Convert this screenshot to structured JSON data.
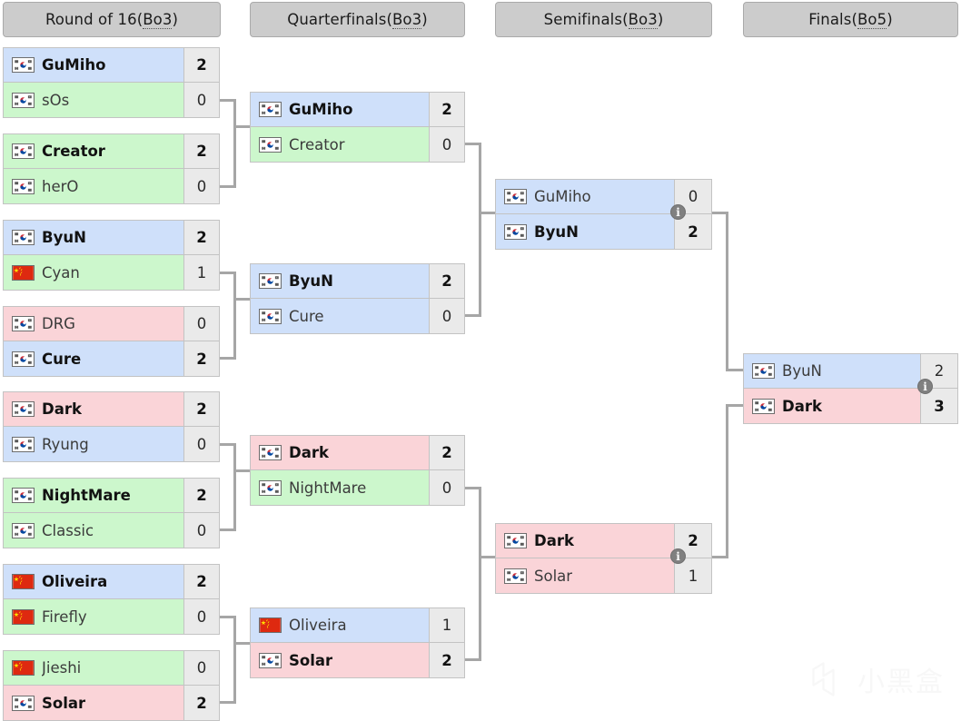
{
  "rounds": [
    {
      "id": "ro16",
      "label": "Round of 16 ",
      "format": "Bo3"
    },
    {
      "id": "qf",
      "label": "Quarterfinals ",
      "format": "Bo3"
    },
    {
      "id": "sf",
      "label": "Semifinals ",
      "format": "Bo3"
    },
    {
      "id": "f",
      "label": "Finals ",
      "format": "Bo5"
    }
  ],
  "colors": {
    "terran": "#cfe0fa",
    "protoss": "#ccf7cc",
    "zerg": "#fad4d8",
    "header": "#cccccc",
    "score_bg": "#eaeaea",
    "connector": "#a6a6a6"
  },
  "matches": {
    "ro16_1": {
      "top": {
        "name": "GuMiho",
        "score": "2",
        "flag": "kr",
        "race": "terran",
        "winner": true
      },
      "bottom": {
        "name": "sOs",
        "score": "0",
        "flag": "kr",
        "race": "protoss",
        "winner": false
      }
    },
    "ro16_2": {
      "top": {
        "name": "Creator",
        "score": "2",
        "flag": "kr",
        "race": "protoss",
        "winner": true
      },
      "bottom": {
        "name": "herO",
        "score": "0",
        "flag": "kr",
        "race": "protoss",
        "winner": false
      }
    },
    "ro16_3": {
      "top": {
        "name": "ByuN",
        "score": "2",
        "flag": "kr",
        "race": "terran",
        "winner": true
      },
      "bottom": {
        "name": "Cyan",
        "score": "1",
        "flag": "cn",
        "race": "protoss",
        "winner": false
      }
    },
    "ro16_4": {
      "top": {
        "name": "DRG",
        "score": "0",
        "flag": "kr",
        "race": "zerg",
        "winner": false
      },
      "bottom": {
        "name": "Cure",
        "score": "2",
        "flag": "kr",
        "race": "terran",
        "winner": true
      }
    },
    "ro16_5": {
      "top": {
        "name": "Dark",
        "score": "2",
        "flag": "kr",
        "race": "zerg",
        "winner": true
      },
      "bottom": {
        "name": "Ryung",
        "score": "0",
        "flag": "kr",
        "race": "terran",
        "winner": false
      }
    },
    "ro16_6": {
      "top": {
        "name": "NightMare",
        "score": "2",
        "flag": "kr",
        "race": "protoss",
        "winner": true
      },
      "bottom": {
        "name": "Classic",
        "score": "0",
        "flag": "kr",
        "race": "protoss",
        "winner": false
      }
    },
    "ro16_7": {
      "top": {
        "name": "Oliveira",
        "score": "2",
        "flag": "cn",
        "race": "terran",
        "winner": true
      },
      "bottom": {
        "name": "Firefly",
        "score": "0",
        "flag": "cn",
        "race": "protoss",
        "winner": false
      }
    },
    "ro16_8": {
      "top": {
        "name": "Jieshi",
        "score": "0",
        "flag": "cn",
        "race": "protoss",
        "winner": false
      },
      "bottom": {
        "name": "Solar",
        "score": "2",
        "flag": "kr",
        "race": "zerg",
        "winner": true
      }
    },
    "qf_1": {
      "top": {
        "name": "GuMiho",
        "score": "2",
        "flag": "kr",
        "race": "terran",
        "winner": true
      },
      "bottom": {
        "name": "Creator",
        "score": "0",
        "flag": "kr",
        "race": "protoss",
        "winner": false
      }
    },
    "qf_2": {
      "top": {
        "name": "ByuN",
        "score": "2",
        "flag": "kr",
        "race": "terran",
        "winner": true
      },
      "bottom": {
        "name": "Cure",
        "score": "0",
        "flag": "kr",
        "race": "terran",
        "winner": false
      }
    },
    "qf_3": {
      "top": {
        "name": "Dark",
        "score": "2",
        "flag": "kr",
        "race": "zerg",
        "winner": true
      },
      "bottom": {
        "name": "NightMare",
        "score": "0",
        "flag": "kr",
        "race": "protoss",
        "winner": false
      }
    },
    "qf_4": {
      "top": {
        "name": "Oliveira",
        "score": "1",
        "flag": "cn",
        "race": "terran",
        "winner": false
      },
      "bottom": {
        "name": "Solar",
        "score": "2",
        "flag": "kr",
        "race": "zerg",
        "winner": true
      }
    },
    "sf_1": {
      "top": {
        "name": "GuMiho",
        "score": "0",
        "flag": "kr",
        "race": "terran",
        "winner": false
      },
      "bottom": {
        "name": "ByuN",
        "score": "2",
        "flag": "kr",
        "race": "terran",
        "winner": true
      },
      "info": "i"
    },
    "sf_2": {
      "top": {
        "name": "Dark",
        "score": "2",
        "flag": "kr",
        "race": "zerg",
        "winner": true
      },
      "bottom": {
        "name": "Solar",
        "score": "1",
        "flag": "kr",
        "race": "zerg",
        "winner": false
      },
      "info": "i"
    },
    "final": {
      "top": {
        "name": "ByuN",
        "score": "2",
        "flag": "kr",
        "race": "terran",
        "winner": false
      },
      "bottom": {
        "name": "Dark",
        "score": "3",
        "flag": "kr",
        "race": "zerg",
        "winner": true
      },
      "info": "i"
    }
  },
  "watermark": {
    "text": "小黑盒"
  }
}
